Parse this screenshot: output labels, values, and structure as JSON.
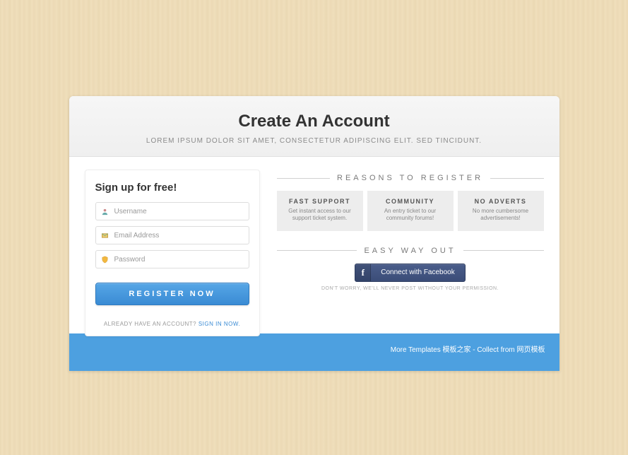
{
  "header": {
    "title": "Create An Account",
    "subtitle": "LOREM IPSUM DOLOR SIT AMET, CONSECTETUR ADIPISCING ELIT. SED TINCIDUNT."
  },
  "signup": {
    "heading": "Sign up for free!",
    "username_placeholder": "Username",
    "email_placeholder": "Email Address",
    "password_placeholder": "Password",
    "button_label": "REGISTER NOW",
    "already_prefix": "ALREADY HAVE AN ACCOUNT? ",
    "already_link": "SIGN IN NOW."
  },
  "reasons": {
    "heading": "REASONS TO REGISTER",
    "cards": [
      {
        "title": "FAST SUPPORT",
        "desc": "Get instant access to our support ticket system."
      },
      {
        "title": "COMMUNITY",
        "desc": "An entry ticket to our community forums!"
      },
      {
        "title": "NO ADVERTS",
        "desc": "No more cumbersome advertisements!"
      }
    ]
  },
  "easy": {
    "heading": "EASY WAY OUT",
    "fb_label": "Connect with Facebook",
    "note": "DON'T WORRY, WE'LL NEVER POST WITHOUT YOUR PERMISSION."
  },
  "footer": {
    "more": "More Templates ",
    "link1": "模板之家",
    "sep": " - Collect from ",
    "link2": "网页模板"
  }
}
